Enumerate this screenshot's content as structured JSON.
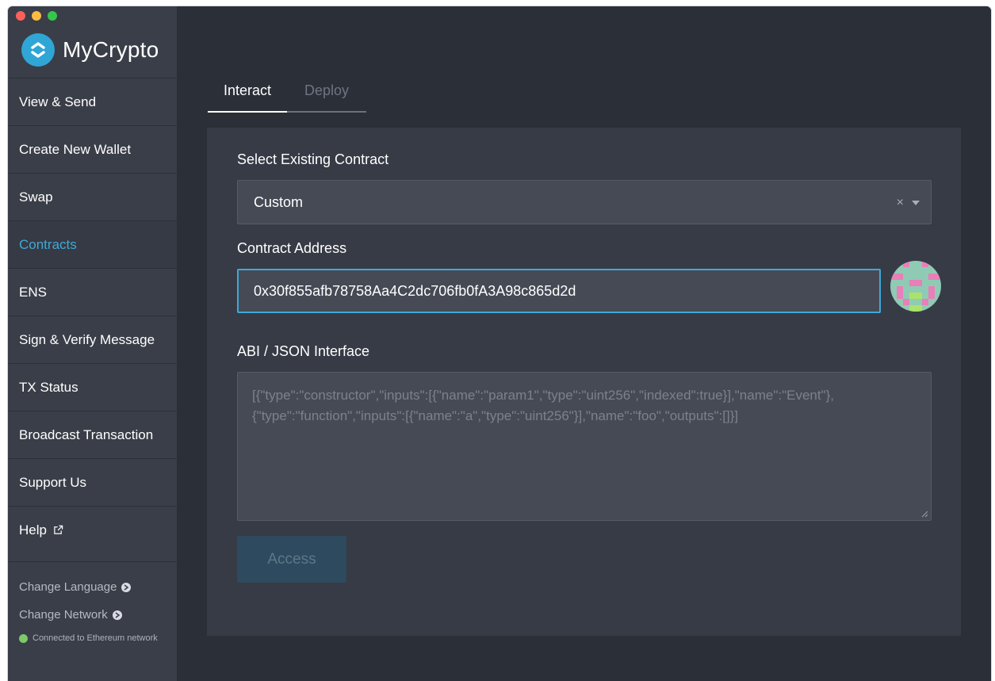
{
  "window": {
    "traffic_lights": [
      "#fc605b",
      "#fdbc40",
      "#34c84a"
    ]
  },
  "brand": {
    "name": "MyCrypto",
    "logo_icon": "mycrypto-logo-icon",
    "accent": "#2fa6d6"
  },
  "sidebar": {
    "items": [
      {
        "label": "View & Send",
        "active": false
      },
      {
        "label": "Create New Wallet",
        "active": false
      },
      {
        "label": "Swap",
        "active": false
      },
      {
        "label": "Contracts",
        "active": true
      },
      {
        "label": "ENS",
        "active": false
      },
      {
        "label": "Sign & Verify Message",
        "active": false
      },
      {
        "label": "TX Status",
        "active": false
      },
      {
        "label": "Broadcast Transaction",
        "active": false
      },
      {
        "label": "Support Us",
        "active": false
      },
      {
        "label": "Help",
        "active": false,
        "icon": "external-link-icon"
      }
    ],
    "change_language": "Change Language",
    "change_network": "Change Network",
    "network_status": "Connected to Ethereum network",
    "active_color": "#3ea9d9"
  },
  "tabs": {
    "interact": "Interact",
    "deploy": "Deploy",
    "active": "Interact"
  },
  "form": {
    "select_label": "Select Existing Contract",
    "select_value": "Custom",
    "clear_glyph": "×",
    "address_label": "Contract Address",
    "address_value": "0x30f855afb78758Aa4C2dc706fb0fA3A98c865d2d",
    "abi_label": "ABI / JSON Interface",
    "abi_placeholder": "[{\"type\":\"constructor\",\"inputs\":[{\"name\":\"param1\",\"type\":\"uint256\",\"indexed\":true}],\"name\":\"Event\"},{\"type\":\"function\",\"inputs\":[{\"name\":\"a\",\"type\":\"uint256\"}],\"name\":\"foo\",\"outputs\":[]}]",
    "abi_value": "",
    "access_button": "Access",
    "access_enabled": false
  }
}
